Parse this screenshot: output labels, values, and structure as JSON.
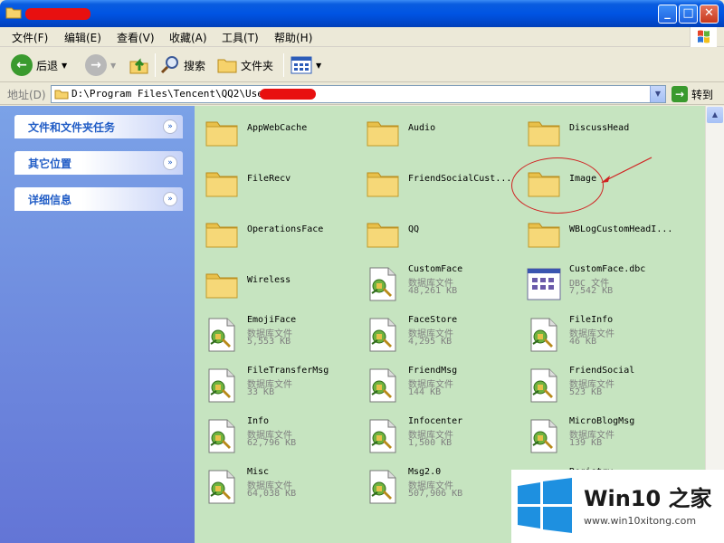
{
  "window": {
    "title": ""
  },
  "menu": [
    {
      "label": "文件(F)"
    },
    {
      "label": "编辑(E)"
    },
    {
      "label": "查看(V)"
    },
    {
      "label": "收藏(A)"
    },
    {
      "label": "工具(T)"
    },
    {
      "label": "帮助(H)"
    }
  ],
  "toolbar": {
    "back_label": "后退",
    "search_label": "搜索",
    "folders_label": "文件夹"
  },
  "address": {
    "label": "地址(D)",
    "path": "D:\\Program Files\\Tencent\\QQ2\\Users\\",
    "go_label": "转到"
  },
  "tasks": [
    {
      "title": "文件和文件夹任务"
    },
    {
      "title": "其它位置"
    },
    {
      "title": "详细信息"
    }
  ],
  "items": [
    {
      "name": "AppWebCache",
      "kind": "folder"
    },
    {
      "name": "Audio",
      "kind": "folder"
    },
    {
      "name": "DiscussHead",
      "kind": "folder"
    },
    {
      "name": "FileRecv",
      "kind": "folder"
    },
    {
      "name": "FriendSocialCust...",
      "kind": "folder"
    },
    {
      "name": "Image",
      "kind": "folder"
    },
    {
      "name": "OperationsFace",
      "kind": "folder"
    },
    {
      "name": "QQ",
      "kind": "folder"
    },
    {
      "name": "WBLogCustomHeadI...",
      "kind": "folder"
    },
    {
      "name": "Wireless",
      "kind": "folder"
    },
    {
      "name": "CustomFace",
      "kind": "db",
      "type": "数据库文件",
      "size": "48,261 KB"
    },
    {
      "name": "CustomFace.dbc",
      "kind": "dbc",
      "type": "DBC 文件",
      "size": "7,542 KB"
    },
    {
      "name": "EmojiFace",
      "kind": "db",
      "type": "数据库文件",
      "size": "5,553 KB"
    },
    {
      "name": "FaceStore",
      "kind": "db",
      "type": "数据库文件",
      "size": "4,295 KB"
    },
    {
      "name": "FileInfo",
      "kind": "db",
      "type": "数据库文件",
      "size": "46 KB"
    },
    {
      "name": "FileTransferMsg",
      "kind": "db",
      "type": "数据库文件",
      "size": "33 KB"
    },
    {
      "name": "FriendMsg",
      "kind": "db",
      "type": "数据库文件",
      "size": "144 KB"
    },
    {
      "name": "FriendSocial",
      "kind": "db",
      "type": "数据库文件",
      "size": "523 KB"
    },
    {
      "name": "Info",
      "kind": "db",
      "type": "数据库文件",
      "size": "62,796 KB"
    },
    {
      "name": "Infocenter",
      "kind": "db",
      "type": "数据库文件",
      "size": "1,500 KB"
    },
    {
      "name": "MicroBlogMsg",
      "kind": "db",
      "type": "数据库文件",
      "size": "139 KB"
    },
    {
      "name": "Misc",
      "kind": "db",
      "type": "数据库文件",
      "size": "64,038 KB"
    },
    {
      "name": "Msg2.0",
      "kind": "db",
      "type": "数据库文件",
      "size": "507,906 KB"
    },
    {
      "name": "Registry",
      "kind": "db",
      "type": "",
      "size": ""
    }
  ],
  "watermark": {
    "brand": "Win10 之家",
    "url": "www.win10xitong.com"
  }
}
